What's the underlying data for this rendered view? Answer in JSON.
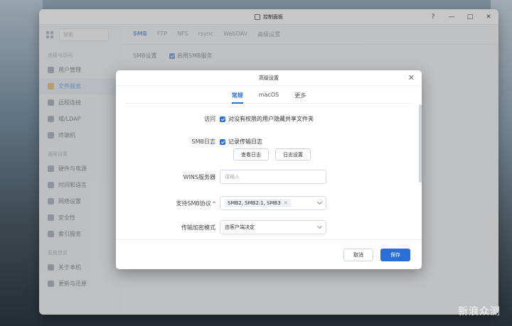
{
  "window": {
    "title": "控制面板"
  },
  "sidebar": {
    "search_placeholder": "搜索",
    "section1": "连接与访问",
    "items1": [
      "用户管理",
      "文件服务",
      "远程连接",
      "域/LDAP",
      "终端机"
    ],
    "section2": "通用设置",
    "items2": [
      "硬件与电源",
      "时间和语言",
      "网络设置",
      "安全性",
      "索引服务"
    ],
    "section3": "系统信息",
    "items3": [
      "关于本机",
      "更新与还原"
    ]
  },
  "content": {
    "tabs": [
      "SMB",
      "FTP",
      "NFS",
      "rsync",
      "WebDAV",
      "高级设置"
    ],
    "smb_label": "SMB设置",
    "smb_enable": "启用SMB服务"
  },
  "modal": {
    "title": "高级设置",
    "tabs": [
      "常规",
      "macOS",
      "更多"
    ],
    "access_label": "访问",
    "access_option": "对没有权限的用户隐藏共享文件夹",
    "log_label": "SMB日志",
    "log_option": "记录传输日志",
    "view_log_button": "查看日志",
    "log_settings_button": "日志设置",
    "wins_label": "WINS服务器",
    "wins_placeholder": "请输入",
    "protocol_label": "支持SMB协议",
    "protocol_value": "SMB2, SMB2.1, SMB3",
    "encryption_label": "传输加密模式",
    "encryption_value": "由客户端决定",
    "cancel_button": "取消",
    "save_button": "保存"
  },
  "watermark": "新浪众测",
  "colors": {
    "accent": "#2a6fd6",
    "required": "#e04848"
  }
}
